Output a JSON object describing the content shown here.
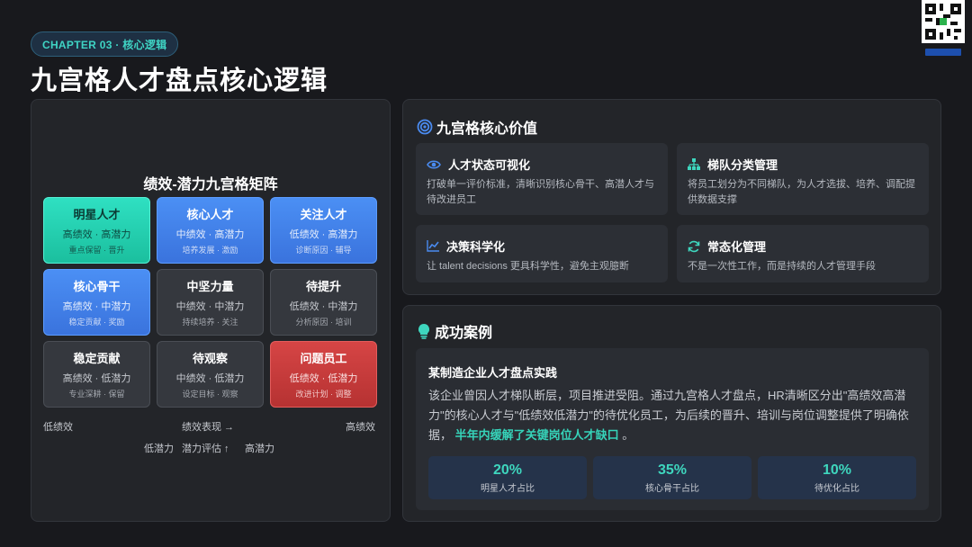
{
  "header": {
    "chapter": "CHAPTER 03 · 核心逻辑",
    "title": "九宫格人才盘点核心逻辑"
  },
  "matrix": {
    "title": "绩效-潜力九宫格矩阵",
    "cells": [
      {
        "title": "明星人才",
        "sub": "高绩效 · 高潜力",
        "note": "重点保留 · 晋升",
        "color": "#22cfb0"
      },
      {
        "title": "核心人才",
        "sub": "中绩效 · 高潜力",
        "note": "培养发展 · 激励",
        "color": "#4283ea"
      },
      {
        "title": "关注人才",
        "sub": "低绩效 · 高潜力",
        "note": "诊断原因 · 辅导",
        "color": "#4283ea"
      },
      {
        "title": "核心骨干",
        "sub": "高绩效 · 中潜力",
        "note": "稳定贡献 · 奖励",
        "color": "#4283ea"
      },
      {
        "title": "中坚力量",
        "sub": "中绩效 · 中潜力",
        "note": "持续培养 · 关注",
        "color": "#35383e"
      },
      {
        "title": "待提升",
        "sub": "低绩效 · 中潜力",
        "note": "分析原因 · 培训",
        "color": "#35383e"
      },
      {
        "title": "稳定贡献",
        "sub": "高绩效 · 低潜力",
        "note": "专业深耕 · 保留",
        "color": "#35383e"
      },
      {
        "title": "待观察",
        "sub": "中绩效 · 低潜力",
        "note": "设定目标 · 观察",
        "color": "#35383e"
      },
      {
        "title": "问题员工",
        "sub": "低绩效 · 低潜力",
        "note": "改进计划 · 调整",
        "color": "#c93c3c"
      }
    ],
    "x_low": "低绩效",
    "x_label": "绩效表现 →",
    "x_high": "高绩效",
    "y_low": "低潜力",
    "y_label": "潜力评估 ↑",
    "y_high": "高潜力"
  },
  "values": {
    "title": "九宫格核心价值",
    "cards": [
      {
        "title": "人才状态可视化",
        "desc": "打破单一评价标准，清晰识别核心骨干、高潜人才与待改进员工",
        "icon": "eye-icon"
      },
      {
        "title": "梯队分类管理",
        "desc": "将员工划分为不同梯队，为人才选拔、培养、调配提供数据支撑",
        "icon": "org-chart-icon"
      },
      {
        "title": "决策科学化",
        "desc": "让 talent decisions 更具科学性，避免主观臆断",
        "icon": "line-chart-icon"
      },
      {
        "title": "常态化管理",
        "desc": "不是一次性工作，而是持续的人才管理手段",
        "icon": "refresh-icon"
      }
    ]
  },
  "case": {
    "title": "成功案例",
    "box_title": "某制造企业人才盘点实践",
    "text": "该企业曾因人才梯队断层，项目推进受阻。通过九宫格人才盘点，HR清晰区分出\"高绩效高潜力\"的核心人才与\"低绩效低潜力\"的待优化员工，为后续的晋升、培训与岗位调整提供了明确依据，",
    "highlight": "半年内缓解了关键岗位人才缺口",
    "suffix": "。",
    "stats": [
      {
        "value": "20%",
        "label": "明星人才占比"
      },
      {
        "value": "35%",
        "label": "核心骨干占比"
      },
      {
        "value": "10%",
        "label": "待优化占比"
      }
    ]
  },
  "colors": {
    "accent": "#36d3b9",
    "background": "#18191d",
    "panel": "#232529"
  }
}
